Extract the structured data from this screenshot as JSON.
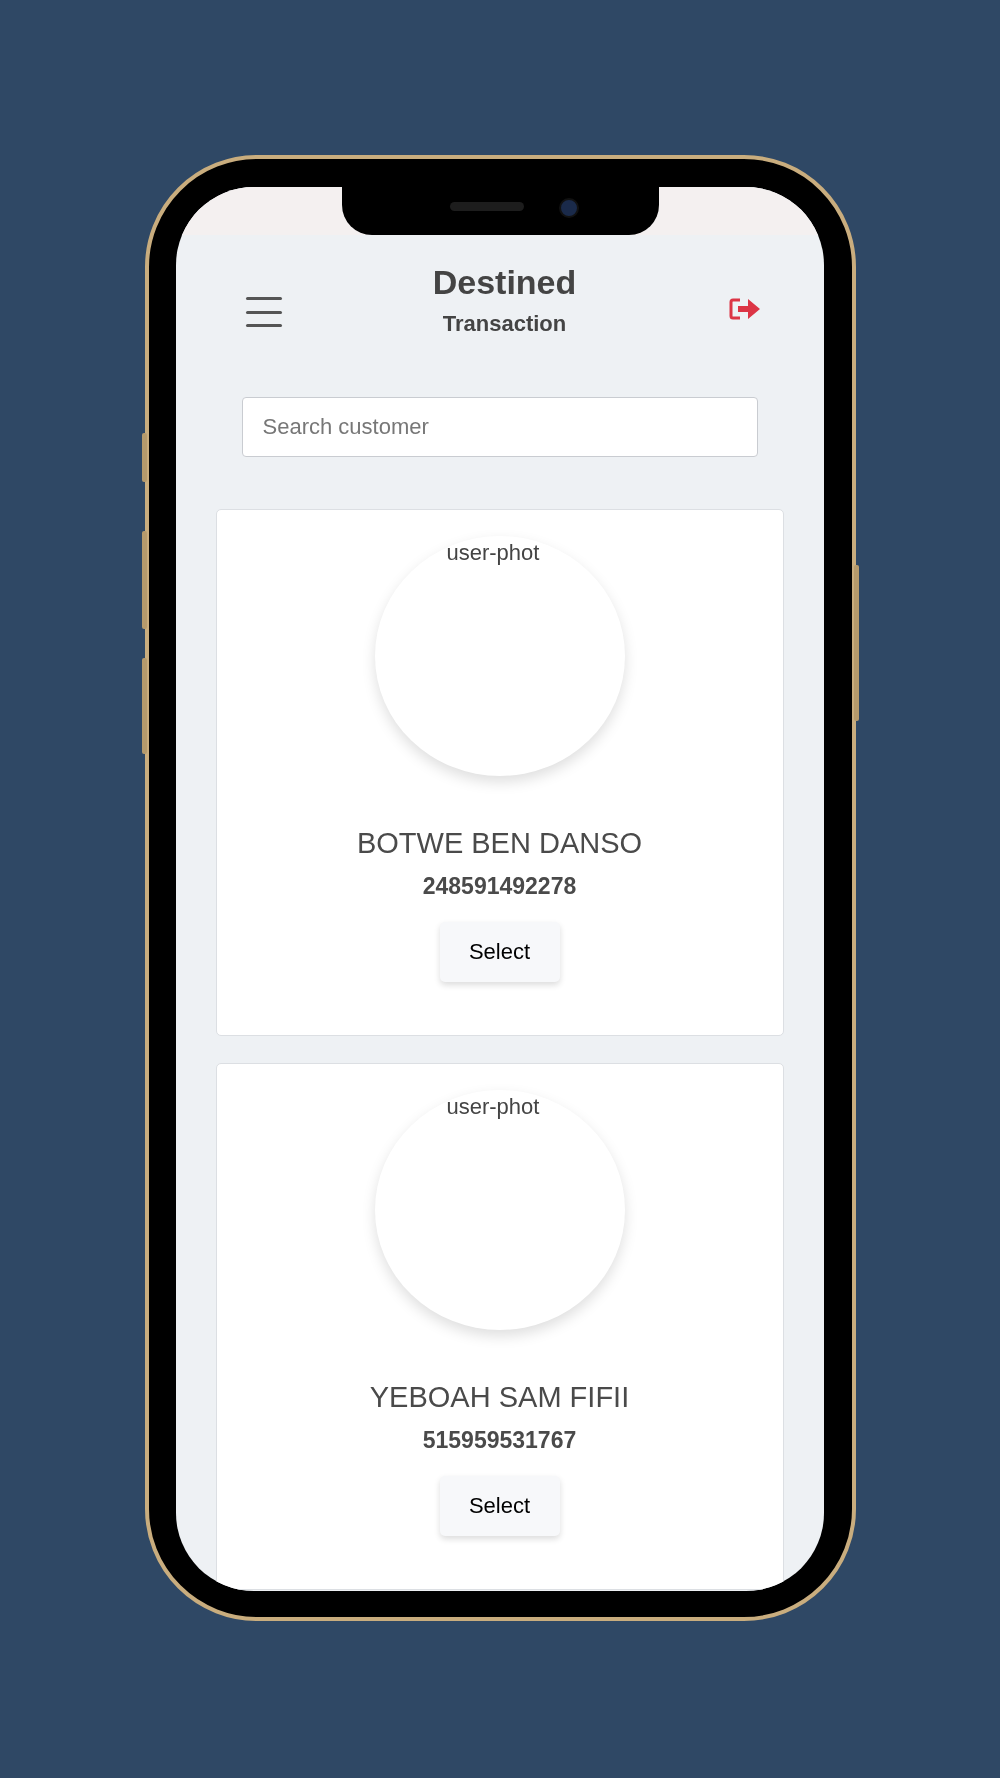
{
  "header": {
    "title": "Destined",
    "subtitle": "Transaction"
  },
  "search": {
    "placeholder": "Search customer"
  },
  "customers": [
    {
      "photo_alt": "user-phot",
      "name": "BOTWE BEN DANSO",
      "account": "248591492278",
      "button": "Select"
    },
    {
      "photo_alt": "user-phot",
      "name": "YEBOAH SAM FIFII",
      "account": "515959531767",
      "button": "Select"
    }
  ]
}
